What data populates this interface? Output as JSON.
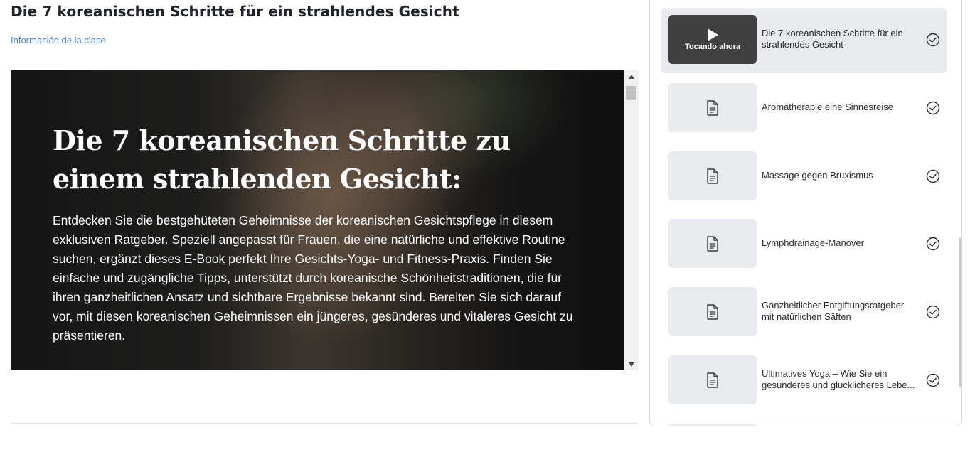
{
  "lesson": {
    "title": "Die 7 koreanischen Schritte für ein strahlendes Gesicht",
    "info_link": "Información de la clase"
  },
  "viewer": {
    "heading": "Die 7 koreanischen Schritte zu einem strahlenden Gesicht:",
    "body": "Entdecken Sie die bestgehüteten Geheimnisse der koreanischen Gesichtspflege in diesem exklusiven Ratgeber. Speziell angepasst für Frauen, die eine natürliche und effektive Routine suchen, ergänzt dieses E-Book perfekt Ihre Gesichts-Yoga- und Fitness-Praxis. Finden Sie einfache und zugängliche Tipps, unterstützt durch koreanische Schönheitstraditionen, die für ihren ganzheitlichen Ansatz und sichtbare Ergebnisse bekannt sind. Bereiten Sie sich darauf vor, mit diesen koreanischen Geheimnissen ein jüngeres, gesünderes und vitaleres Gesicht zu präsentieren.",
    "scroll_up_icon": "triangle-up-icon",
    "scroll_down_icon": "triangle-down-icon"
  },
  "sidebar": {
    "now_playing_label": "Tocando ahora",
    "items": [
      {
        "title_line1": "Die 7 koreanischen Schritte für ein",
        "title_line2": "strahlendes Gesicht",
        "active": true,
        "icon": "play-icon",
        "completed": true
      },
      {
        "title_line1": "Aromatherapie eine Sinnesreise",
        "title_line2": "",
        "active": false,
        "icon": "document-icon",
        "completed": true
      },
      {
        "title_line1": "Massage gegen Bruxismus",
        "title_line2": "",
        "active": false,
        "icon": "document-icon",
        "completed": true
      },
      {
        "title_line1": "Lymphdrainage-Manöver",
        "title_line2": "",
        "active": false,
        "icon": "document-icon",
        "completed": true
      },
      {
        "title_line1": "Ganzheitlicher Entgiftungsratgeber",
        "title_line2": "mit natürlichen Säften",
        "active": false,
        "icon": "document-icon",
        "completed": true
      },
      {
        "title_line1": "Ultimatives Yoga – Wie Sie ein",
        "title_line2": "gesünderes und glücklicheres Lebe...",
        "active": false,
        "icon": "document-icon",
        "completed": true
      }
    ]
  },
  "colors": {
    "link": "#4a7fd9",
    "active_item_bg": "#e8eaee",
    "thumb_active_bg": "#404040"
  }
}
